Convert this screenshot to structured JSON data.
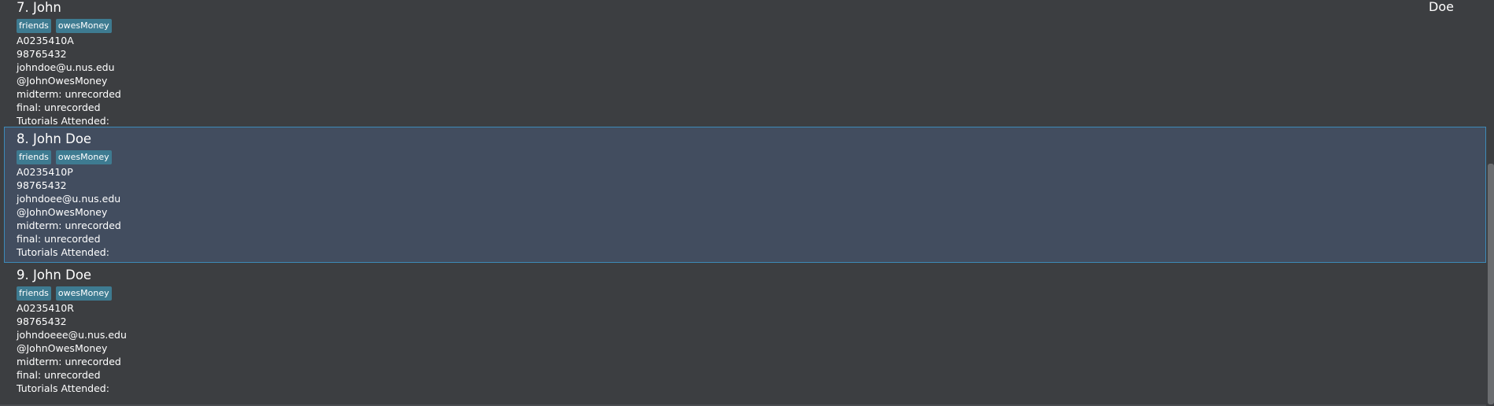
{
  "persons": [
    {
      "index_name": "7. John",
      "tags": [
        "friends",
        "owesMoney"
      ],
      "student_id": "A0235410A",
      "phone": "98765432",
      "email": "johndoe@u.nus.edu",
      "telegram": "@JohnOwesMoney",
      "midterm": "midterm: unrecorded",
      "final": "final: unrecorded",
      "tutorials": "Tutorials Attended:",
      "corner": "Doe"
    },
    {
      "index_name": "8. John Doe",
      "tags": [
        "friends",
        "owesMoney"
      ],
      "student_id": "A0235410P",
      "phone": "98765432",
      "email": "johndoee@u.nus.edu",
      "telegram": "@JohnOwesMoney",
      "midterm": "midterm: unrecorded",
      "final": "final: unrecorded",
      "tutorials": "Tutorials Attended:"
    },
    {
      "index_name": "9. John Doe",
      "tags": [
        "friends",
        "owesMoney"
      ],
      "student_id": "A0235410R",
      "phone": "98765432",
      "email": "johndoeee@u.nus.edu",
      "telegram": "@JohnOwesMoney",
      "midterm": "midterm: unrecorded",
      "final": "final: unrecorded",
      "tutorials": "Tutorials Attended:"
    }
  ],
  "colors": {
    "background": "#3c3e41",
    "selected_background": "#424d5f",
    "selected_border": "#3d8ab8",
    "tag": "#3e7b91"
  }
}
